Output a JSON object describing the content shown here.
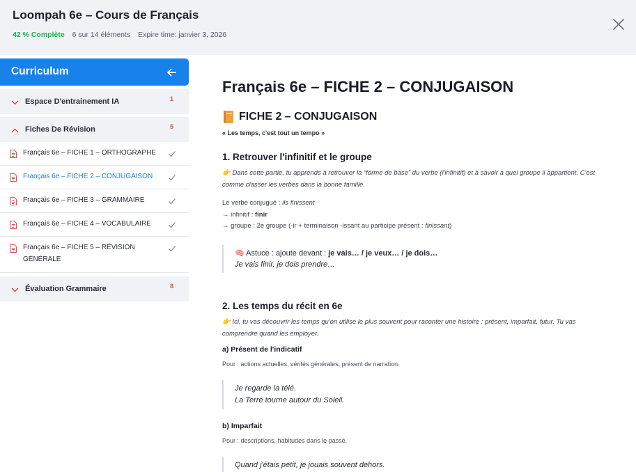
{
  "header": {
    "title": "Loompah 6e – Cours de Français",
    "progress": "42 % Complète",
    "items": "6 sur 14 éléments",
    "expire": "Expire time: janvier 3, 2026"
  },
  "sidebar": {
    "title": "Curriculum",
    "sections": [
      {
        "label": "Espace D'entrainement IA",
        "count": "1"
      },
      {
        "label": "Fiches De Révision",
        "count": "5"
      },
      {
        "label": "Évaluation Grammaire",
        "count": "8"
      }
    ],
    "lessons": [
      {
        "label": "Français 6e – FICHE 1 – ORTHOGRAPHE"
      },
      {
        "label": "Français 6e – FICHE 2 – CONJUGAISON"
      },
      {
        "label": "Français 6e – FICHE 3 – GRAMMAIRE"
      },
      {
        "label": "Français 6e – FICHE 4 – VOCABULAIRE"
      },
      {
        "label": "Français 6e – FICHE 5 – RÉVISION GÉNÉRALE"
      }
    ]
  },
  "content": {
    "title": "Français 6e – FICHE 2 – CONJUGAISON",
    "subtitle": "FICHE 2 – CONJUGAISON",
    "tagline": "« Les temps, c'est tout un tempo »",
    "s1": {
      "heading": "1. Retrouver l'infinitif et le groupe",
      "intro": "👉 Dans cette partie, tu apprends à retrouver la “forme de base” du verbe (l'infinitif) et à savoir à quel groupe il appartient. C'est comme classer les verbes dans la bonne famille.",
      "l1_a": "Le verbe conjugué : ",
      "l1_b": "ils finissent",
      "l2_a": "→ infinitif : ",
      "l2_b": "finir",
      "l3_a": "→ groupe : 2e groupe (-ir + terminaison -issant au participe présent : ",
      "l3_b": "finissant",
      "l3_c": ")",
      "tip_a": "🧠 Astuce : ajoute devant : ",
      "tip_b": "je vais… / je veux… / je dois…",
      "tip_c": "Je vais finir, je dois prendre…"
    },
    "s2": {
      "heading": "2. Les temps du récit en 6e",
      "intro": "👉 Ici, tu vas découvrir les temps qu'on utilise le plus souvent pour raconter une histoire : présent, imparfait, futur. Tu vas comprendre quand les employer.",
      "a_title": "a) Présent de l'indicatif",
      "a_desc": "Pour : actions actuelles, vérités générales, présent de narration.",
      "a_ex1": "Je regarde la télé.",
      "a_ex2": "La Terre tourne autour du Soleil.",
      "b_title": "b) Imparfait",
      "b_desc": "Pour : descriptions, habitudes dans le passé.",
      "b_ex1": "Quand j'étais petit, je jouais souvent dehors."
    }
  },
  "colors": {
    "accent": "#1682ea",
    "progress": "#1db04b",
    "count": "#e24b4b"
  }
}
